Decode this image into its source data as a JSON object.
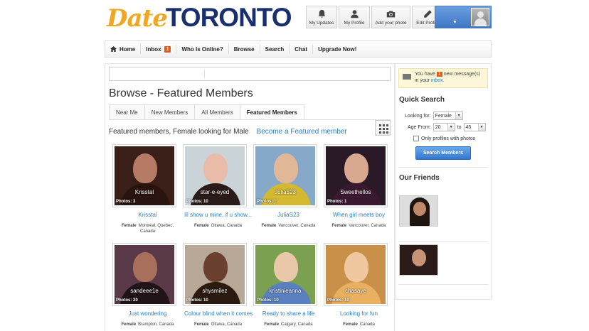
{
  "logo": {
    "part1": "Date",
    "part2": "TORONTO"
  },
  "topnav": [
    {
      "label": "My Updates",
      "icon": "bell-icon"
    },
    {
      "label": "My Profile",
      "icon": "user-icon"
    },
    {
      "label": "Add your photo",
      "icon": "camera-icon"
    },
    {
      "label": "Edit Profile",
      "icon": "pencil-icon"
    }
  ],
  "mainnav": {
    "home": "Home",
    "inbox": "Inbox",
    "inbox_count": "1",
    "who_online": "Who Is Online?",
    "browse": "Browse",
    "search": "Search",
    "chat": "Chat",
    "upgrade": "Upgrade Now!"
  },
  "page": {
    "title": "Browse - Featured Members",
    "tabs": [
      "Near Me",
      "New Members",
      "All Members",
      "Featured Members"
    ],
    "featured_text": "Featured members, Female looking for Male",
    "featured_link": "Become a Featured member"
  },
  "members": [
    {
      "name": "Krisstal",
      "photos": "Photos: 3",
      "title": "Krisstal",
      "gender": "Female",
      "location": "Montréal, Quebec, Canada",
      "c1": "#3a1e18",
      "c2": "#b47a64",
      "c3": "#2a1410"
    },
    {
      "name": "star-e-eyed",
      "photos": "Photos: 10",
      "title": "Ill show u mine, if u show...",
      "gender": "Female",
      "location": "Ottawa, Canada",
      "c1": "#c9d3d8",
      "c2": "#e8bca8",
      "c3": "#2a1a18"
    },
    {
      "name": "Julia523",
      "photos": "Photos: 1",
      "title": "JuliaS23",
      "gender": "Female",
      "location": "Vancouver, Canada",
      "c1": "#86a9c9",
      "c2": "#e0b898",
      "c3": "#d4b830"
    },
    {
      "name": "Sweethellos",
      "photos": "Photos: 1",
      "title": "When girl meets boy",
      "gender": "Female",
      "location": "Vancouver, Canada",
      "c1": "#2a1a28",
      "c2": "#d8a890",
      "c3": "#3a1830"
    },
    {
      "name": "sandeee1e",
      "photos": "Photos: 20",
      "title": "Just wondering",
      "gender": "Female",
      "location": "Brampton, Canada",
      "c1": "#5a3a48",
      "c2": "#a8705a",
      "c3": "#201418"
    },
    {
      "name": "shysmilez",
      "photos": "Photos: 10",
      "title": "Colour blind when it comes...",
      "gender": "Female",
      "location": "Ottawa, Canada",
      "c1": "#b8a898",
      "c2": "#6a4030",
      "c3": "#2a1a10"
    },
    {
      "name": "kristinieanna",
      "photos": "Photos: 10",
      "title": "Ready to share a life",
      "gender": "Female",
      "location": "Calgary, Canada",
      "c1": "#7aa050",
      "c2": "#e8c8a8",
      "c3": "#5a80c0"
    },
    {
      "name": "chasaye",
      "photos": "Photos: 10",
      "title": "Looking for fun",
      "gender": "Female",
      "location": "Canada",
      "c1": "#c89048",
      "c2": "#f0c8a0",
      "c3": "#e8b060"
    }
  ],
  "sidebar": {
    "msg_pre": "You have",
    "msg_count": "1",
    "msg_mid": "new message(s)",
    "msg_in": "in your",
    "msg_link": "inbox.",
    "quick_search": "Quick Search",
    "looking_for_label": "Looking for:",
    "looking_for_value": "Female",
    "age_from_label": "Age From:",
    "age_from": "20",
    "age_to_label": "to",
    "age_to": "45",
    "only_photos": "Only profiles with photos",
    "search_button": "Search Members",
    "our_friends": "Our Friends"
  }
}
